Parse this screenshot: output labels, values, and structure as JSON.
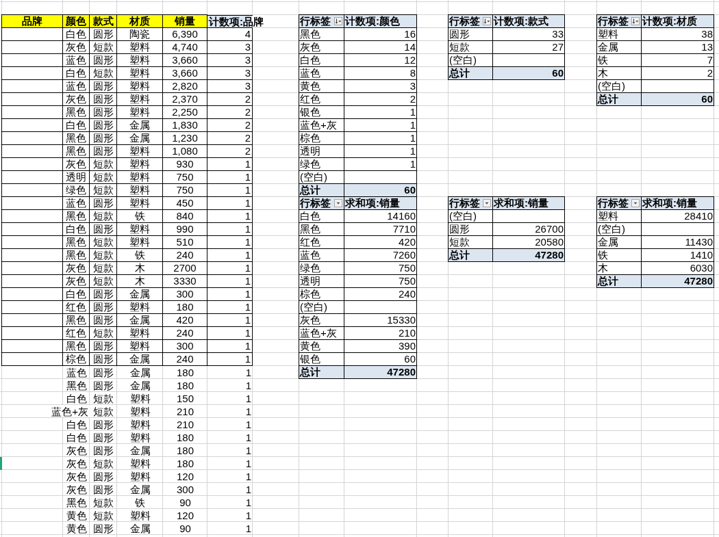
{
  "data_table": {
    "headers": [
      "品牌",
      "颜色",
      "款式",
      "材质",
      "销量"
    ],
    "count_header": "计数项:品牌",
    "rows": [
      {
        "values": [
          "白色",
          "圆形",
          "陶瓷",
          "6,390"
        ],
        "count": "4",
        "bordered": true,
        "selected": false
      },
      {
        "values": [
          "灰色",
          "短款",
          "塑料",
          "4,740"
        ],
        "count": "3",
        "bordered": true,
        "selected": false
      },
      {
        "values": [
          "蓝色",
          "圆形",
          "塑料",
          "3,660"
        ],
        "count": "3",
        "bordered": true,
        "selected": false
      },
      {
        "values": [
          "白色",
          "短款",
          "塑料",
          "3,660"
        ],
        "count": "3",
        "bordered": true,
        "selected": false
      },
      {
        "values": [
          "蓝色",
          "圆形",
          "塑料",
          "2,820"
        ],
        "count": "3",
        "bordered": true,
        "selected": false
      },
      {
        "values": [
          "灰色",
          "圆形",
          "塑料",
          "2,370"
        ],
        "count": "2",
        "bordered": true,
        "selected": false
      },
      {
        "values": [
          "黑色",
          "圆形",
          "塑料",
          "2,250"
        ],
        "count": "2",
        "bordered": true,
        "selected": false
      },
      {
        "values": [
          "白色",
          "圆形",
          "金属",
          "1,830"
        ],
        "count": "2",
        "bordered": true,
        "selected": false
      },
      {
        "values": [
          "黑色",
          "圆形",
          "金属",
          "1,230"
        ],
        "count": "2",
        "bordered": true,
        "selected": false
      },
      {
        "values": [
          "黑色",
          "圆形",
          "塑料",
          "1,080"
        ],
        "count": "2",
        "bordered": true,
        "selected": false
      },
      {
        "values": [
          "灰色",
          "短款",
          "塑料",
          "930"
        ],
        "count": "1",
        "bordered": true,
        "selected": false
      },
      {
        "values": [
          "透明",
          "短款",
          "塑料",
          "750"
        ],
        "count": "1",
        "bordered": true,
        "selected": false
      },
      {
        "values": [
          "绿色",
          "短款",
          "塑料",
          "750"
        ],
        "count": "1",
        "bordered": true,
        "selected": false
      },
      {
        "values": [
          "蓝色",
          "圆形",
          "塑料",
          "450"
        ],
        "count": "1",
        "bordered": true,
        "selected": false
      },
      {
        "values": [
          "黑色",
          "短款",
          "铁",
          "840"
        ],
        "count": "1",
        "bordered": true,
        "selected": false
      },
      {
        "values": [
          "白色",
          "圆形",
          "塑料",
          "990"
        ],
        "count": "1",
        "bordered": true,
        "selected": false
      },
      {
        "values": [
          "黑色",
          "短款",
          "塑料",
          "510"
        ],
        "count": "1",
        "bordered": true,
        "selected": false
      },
      {
        "values": [
          "黑色",
          "短款",
          "铁",
          "240"
        ],
        "count": "1",
        "bordered": true,
        "selected": false
      },
      {
        "values": [
          "灰色",
          "短款",
          "木",
          "2700"
        ],
        "count": "1",
        "bordered": true,
        "selected": false
      },
      {
        "values": [
          "灰色",
          "短款",
          "木",
          "3330"
        ],
        "count": "1",
        "bordered": true,
        "selected": false
      },
      {
        "values": [
          "白色",
          "圆形",
          "金属",
          "300"
        ],
        "count": "1",
        "bordered": true,
        "selected": false
      },
      {
        "values": [
          "红色",
          "圆形",
          "塑料",
          "180"
        ],
        "count": "1",
        "bordered": true,
        "selected": false
      },
      {
        "values": [
          "黑色",
          "圆形",
          "金属",
          "420"
        ],
        "count": "1",
        "bordered": true,
        "selected": false
      },
      {
        "values": [
          "红色",
          "短款",
          "塑料",
          "240"
        ],
        "count": "1",
        "bordered": true,
        "selected": false
      },
      {
        "values": [
          "黑色",
          "圆形",
          "塑料",
          "300"
        ],
        "count": "1",
        "bordered": true,
        "selected": false
      },
      {
        "values": [
          "棕色",
          "圆形",
          "金属",
          "240"
        ],
        "count": "1",
        "bordered": true,
        "selected": false
      },
      {
        "values": [
          "蓝色",
          "圆形",
          "金属",
          "180"
        ],
        "count": "1",
        "bordered": false,
        "selected": false
      },
      {
        "values": [
          "黑色",
          "圆形",
          "金属",
          "180"
        ],
        "count": "1",
        "bordered": false,
        "selected": false
      },
      {
        "values": [
          "白色",
          "短款",
          "塑料",
          "150"
        ],
        "count": "1",
        "bordered": false,
        "selected": false
      },
      {
        "values": [
          "蓝色+灰",
          "短款",
          "塑料",
          "210"
        ],
        "count": "1",
        "bordered": false,
        "selected": false
      },
      {
        "values": [
          "白色",
          "圆形",
          "塑料",
          "210"
        ],
        "count": "1",
        "bordered": false,
        "selected": false
      },
      {
        "values": [
          "白色",
          "圆形",
          "塑料",
          "180"
        ],
        "count": "1",
        "bordered": false,
        "selected": false
      },
      {
        "values": [
          "灰色",
          "圆形",
          "金属",
          "180"
        ],
        "count": "1",
        "bordered": false,
        "selected": false
      },
      {
        "values": [
          "灰色",
          "短款",
          "塑料",
          "180"
        ],
        "count": "1",
        "bordered": false,
        "selected": true
      },
      {
        "values": [
          "灰色",
          "圆形",
          "塑料",
          "120"
        ],
        "count": "1",
        "bordered": false,
        "selected": false
      },
      {
        "values": [
          "灰色",
          "圆形",
          "金属",
          "300"
        ],
        "count": "1",
        "bordered": false,
        "selected": false
      },
      {
        "values": [
          "黑色",
          "短款",
          "铁",
          "90"
        ],
        "count": "1",
        "bordered": false,
        "selected": false
      },
      {
        "values": [
          "黄色",
          "短款",
          "塑料",
          "120"
        ],
        "count": "1",
        "bordered": false,
        "selected": false
      },
      {
        "values": [
          "黄色",
          "圆形",
          "金属",
          "90"
        ],
        "count": "1",
        "bordered": false,
        "selected": false
      }
    ]
  },
  "pivot_bands": [
    [
      {
        "row_header": "行标签",
        "value_header": "计数项:颜色",
        "sorted": true,
        "rows": [
          {
            "label": "黑色",
            "value": "16"
          },
          {
            "label": "灰色",
            "value": "14"
          },
          {
            "label": "白色",
            "value": "12"
          },
          {
            "label": "蓝色",
            "value": "8"
          },
          {
            "label": "黄色",
            "value": "3"
          },
          {
            "label": "红色",
            "value": "2"
          },
          {
            "label": "银色",
            "value": "1"
          },
          {
            "label": "蓝色+灰",
            "value": "1"
          },
          {
            "label": "棕色",
            "value": "1"
          },
          {
            "label": "透明",
            "value": "1"
          },
          {
            "label": "绿色",
            "value": "1"
          },
          {
            "label": "(空白)"
          }
        ],
        "total_label": "总计",
        "total": "60"
      },
      {
        "row_header": "行标签",
        "value_header": "计数项:款式",
        "sorted": true,
        "rows": [
          {
            "label": "圆形",
            "value": "33"
          },
          {
            "label": "短款",
            "value": "27"
          },
          {
            "label": "(空白)"
          }
        ],
        "total_label": "总计",
        "total": "60"
      },
      {
        "row_header": "行标签",
        "value_header": "计数项:材质",
        "sorted": true,
        "rows": [
          {
            "label": "塑料",
            "value": "38"
          },
          {
            "label": "金属",
            "value": "13"
          },
          {
            "label": "铁",
            "value": "7"
          },
          {
            "label": "木",
            "value": "2"
          },
          {
            "label": "(空白)"
          }
        ],
        "total_label": "总计",
        "total": "60"
      }
    ],
    [
      {
        "row_header": "行标签",
        "value_header": "求和项:销量",
        "sorted": false,
        "rows": [
          {
            "label": "白色",
            "value": "14160"
          },
          {
            "label": "黑色",
            "value": "7710"
          },
          {
            "label": "红色",
            "value": "420"
          },
          {
            "label": "蓝色",
            "value": "7260"
          },
          {
            "label": "绿色",
            "value": "750"
          },
          {
            "label": "透明",
            "value": "750"
          },
          {
            "label": "棕色",
            "value": "240"
          },
          {
            "label": "(空白)"
          },
          {
            "label": "灰色",
            "value": "15330"
          },
          {
            "label": "蓝色+灰",
            "value": "210"
          },
          {
            "label": "黄色",
            "value": "390"
          },
          {
            "label": "银色",
            "value": "60"
          }
        ],
        "total_label": "总计",
        "total": "47280"
      },
      {
        "row_header": "行标签",
        "value_header": "求和项:销量",
        "sorted": false,
        "rows": [
          {
            "label": "(空白)"
          },
          {
            "label": "圆形",
            "value": "26700"
          },
          {
            "label": "短款",
            "value": "20580"
          }
        ],
        "total_label": "总计",
        "total": "47280"
      },
      {
        "row_header": "行标签",
        "value_header": "求和项:销量",
        "sorted": false,
        "rows": [
          {
            "label": "塑料",
            "value": "28410"
          },
          {
            "label": "(空白)"
          },
          {
            "label": "金属",
            "value": "11430"
          },
          {
            "label": "铁",
            "value": "1410"
          },
          {
            "label": "木",
            "value": "6030"
          }
        ],
        "total_label": "总计",
        "total": "47280"
      }
    ]
  ]
}
